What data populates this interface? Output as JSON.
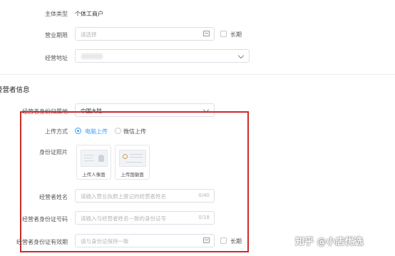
{
  "basic": {
    "subject_type_label": "主体类型",
    "subject_type_value": "个体工商户",
    "business_period_label": "营业期限",
    "business_period_placeholder": "请选择",
    "business_period_longterm": "长期",
    "business_address_label": "经营地址"
  },
  "operator": {
    "section_title": "经营者信息",
    "id_region_label": "经营者身份归属地",
    "id_region_value": "中国大陆",
    "upload_method_label": "上传方式",
    "upload_options": [
      "电脑上传",
      "微信上传"
    ],
    "upload_selected": 0,
    "id_photo_label": "身份证照片",
    "id_front_caption": "上传人像面",
    "id_back_caption": "上传国徽面",
    "name_label": "经营者姓名",
    "name_placeholder": "请输入营业执照上登记的经营者姓名",
    "name_counter": "0/40",
    "id_number_label": "经营者身份证号码",
    "id_number_placeholder": "请输入与经营者姓名一致的身份证号",
    "id_number_counter": "0/18",
    "id_valid_label": "经营者身份证有效期",
    "id_valid_placeholder": "请与身份证保持一致",
    "id_valid_longterm": "长期"
  },
  "watermark": "知乎 @小店优选",
  "colors": {
    "accent": "#409eff",
    "highlight_border": "#cc2a2a"
  }
}
